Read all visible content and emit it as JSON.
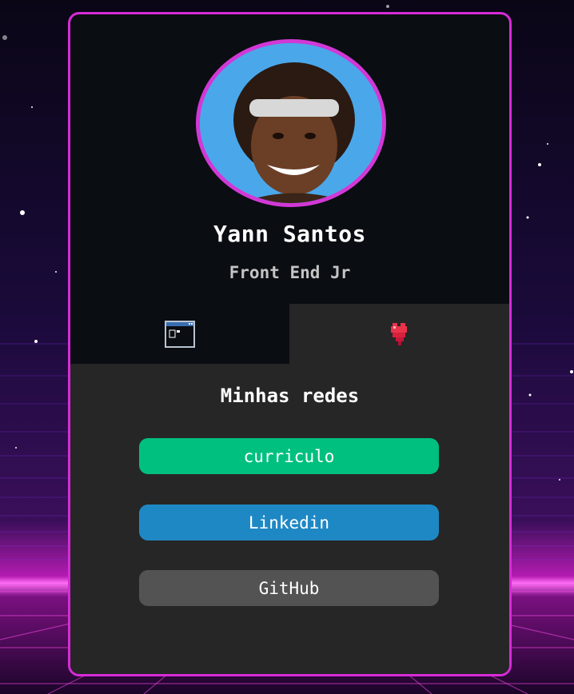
{
  "profile": {
    "name": "Yann Santos",
    "role": "Front End Jr"
  },
  "tabs": [
    {
      "icon": "window-icon",
      "active": false
    },
    {
      "icon": "heart-icon",
      "active": true
    }
  ],
  "links": {
    "title": "Minhas redes",
    "buttons": [
      {
        "label": "curriculo",
        "color": "#00c07f"
      },
      {
        "label": "Linkedin",
        "color": "#1e88c4"
      },
      {
        "label": "GitHub",
        "color": "#535353"
      }
    ]
  },
  "colors": {
    "accent": "#d72bd8",
    "card_dark": "#0a0d12",
    "panel": "#262626"
  }
}
